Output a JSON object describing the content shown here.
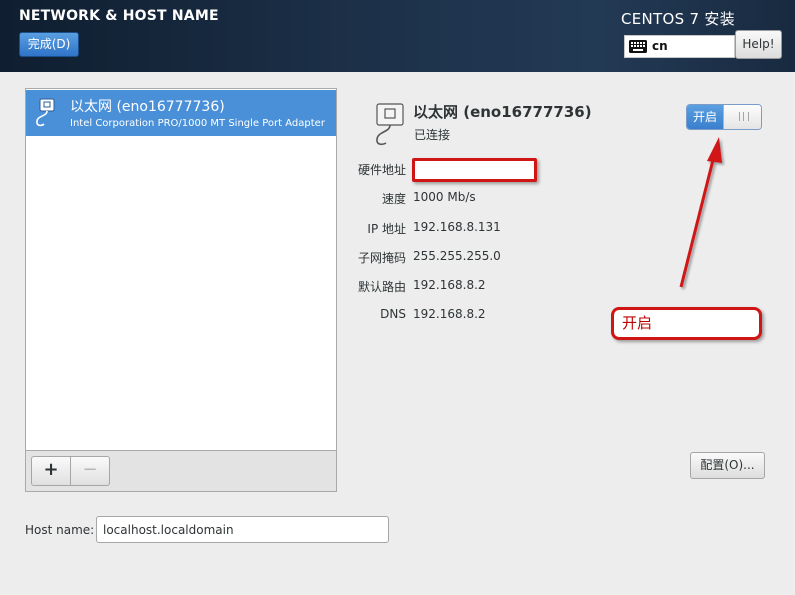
{
  "header": {
    "title": "NETWORK & HOST NAME",
    "done_label": "完成(D)",
    "brand": "CENTOS 7 安装",
    "keyboard_layout": "cn",
    "help_label": "Help!"
  },
  "device_list": {
    "items": [
      {
        "name": "以太网 (eno16777736)",
        "description": "Intel Corporation PRO/1000 MT Single Port Adapter",
        "selected": true
      }
    ],
    "add_label": "+",
    "remove_label": "−"
  },
  "details": {
    "name": "以太网 (eno16777736)",
    "status": "已连接",
    "toggle_label": "开启",
    "toggle_on": true,
    "properties": [
      {
        "label": "硬件地址",
        "value": ""
      },
      {
        "label": "速度",
        "value": "1000 Mb/s"
      },
      {
        "label": "IP 地址",
        "value": "192.168.8.131"
      },
      {
        "label": "子网掩码",
        "value": "255.255.255.0"
      },
      {
        "label": "默认路由",
        "value": "192.168.8.2"
      },
      {
        "label": "DNS",
        "value": "192.168.8.2"
      }
    ],
    "configure_label": "配置(O)..."
  },
  "annotation": {
    "callout_text": "开启",
    "color": "#d01515"
  },
  "hostname": {
    "label": "Host name:",
    "value": "localhost.localdomain"
  },
  "colors": {
    "header_bg": "#1c3048",
    "accent": "#4a90d9",
    "window_bg": "#ededed"
  }
}
